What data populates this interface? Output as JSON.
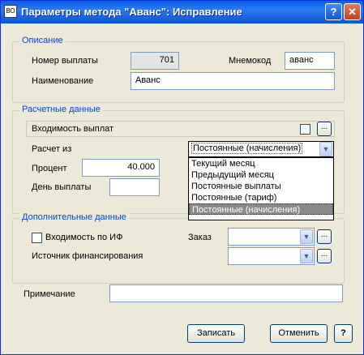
{
  "window": {
    "icon_text": "ВО",
    "title": "Параметры метода \"Аванс\": Исправление",
    "help_glyph": "?",
    "close_glyph": "✕"
  },
  "opisanie": {
    "legend": "Описание",
    "nomer_label": "Номер выплаты",
    "nomer_value": "701",
    "mnemokod_label": "Мнемокод",
    "mnemokod_value": "аванс",
    "naimenovanie_label": "Наименование",
    "naimenovanie_value": "Аванс"
  },
  "raschetnye": {
    "legend": "Расчетные данные",
    "vhodimost_label": "Входимость выплат",
    "vhodimost_checked": false,
    "ellipsis": "...",
    "raschet_label": "Расчет из",
    "raschet_value": "Постоянные (начисления)",
    "procent_label": "Процент",
    "procent_value": "40.000",
    "den_label": "День выплаты",
    "den_value": "",
    "dropdown_options": [
      "Текущий месяц",
      "Предыдущий месяц",
      "Постоянные выплаты",
      "Постоянные (тариф)",
      "Постоянные (начисления)"
    ]
  },
  "dopolnitelnye": {
    "legend": "Дополнительные данные",
    "vhodimost_if_label": "Входимость по ИФ",
    "vhodimost_if_checked": false,
    "zakaz_label": "Заказ",
    "zakaz_value": "",
    "istochnik_label": "Источник финансирования",
    "istochnik_value": "",
    "ellipsis": "..."
  },
  "primechanie": {
    "label": "Примечание",
    "value": ""
  },
  "footer": {
    "save_label": "Записать",
    "cancel_label": "Отменить",
    "help_label": "?"
  }
}
